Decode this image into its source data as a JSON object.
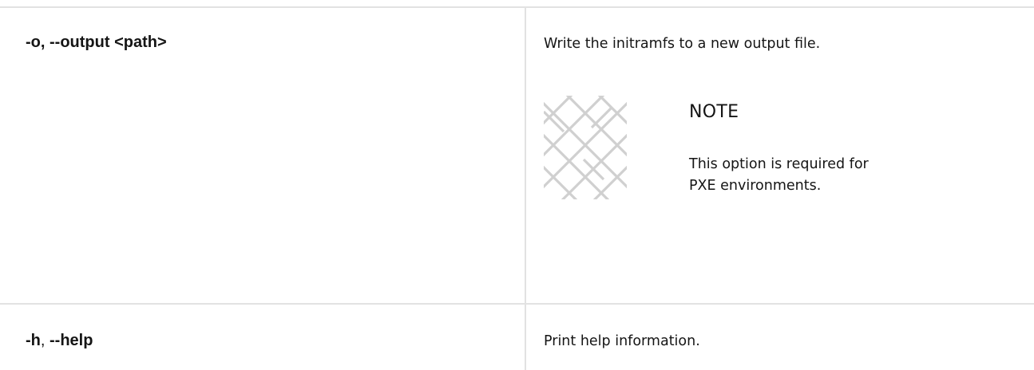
{
  "rows": [
    {
      "option_short": "-o,",
      "option_long": "--output <path>",
      "description": "Write the initramfs to a new output file.",
      "note": {
        "icon": "note-pattern-icon",
        "heading": "NOTE",
        "text": "This option is required for PXE environments."
      }
    },
    {
      "option_short": "-h",
      "option_sep": ",",
      "option_long": "--help",
      "description": "Print help information."
    }
  ],
  "colors": {
    "border": "#e2e2e2",
    "text": "#151515",
    "icon": "#d2d2d2"
  }
}
